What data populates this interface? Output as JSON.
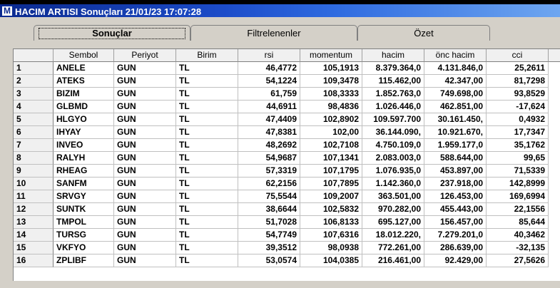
{
  "window": {
    "app_icon_letter": "M",
    "title": "HACIM ARTISI Sonuçları  21/01/23 17:07:28"
  },
  "tabs": [
    {
      "label": "Sonuçlar",
      "active": true
    },
    {
      "label": "Filtrelenenler",
      "active": false
    },
    {
      "label": "Özet",
      "active": false
    }
  ],
  "table": {
    "columns": [
      "Sembol",
      "Periyot",
      "Birim",
      "rsi",
      "momentum",
      "hacim",
      "önc hacim",
      "cci"
    ],
    "rows": [
      [
        "1",
        "ANELE",
        "GUN",
        "TL",
        "46,4772",
        "105,1913",
        "8.379.364,0",
        "4.131.846,0",
        "25,2611"
      ],
      [
        "2",
        "ATEKS",
        "GUN",
        "TL",
        "54,1224",
        "109,3478",
        "115.462,00",
        "42.347,00",
        "81,7298"
      ],
      [
        "3",
        "BIZIM",
        "GUN",
        "TL",
        "61,759",
        "108,3333",
        "1.852.763,0",
        "749.698,00",
        "93,8529"
      ],
      [
        "4",
        "GLBMD",
        "GUN",
        "TL",
        "44,6911",
        "98,4836",
        "1.026.446,0",
        "462.851,00",
        "-17,624"
      ],
      [
        "5",
        "HLGYO",
        "GUN",
        "TL",
        "47,4409",
        "102,8902",
        "109.597.700",
        "30.161.450,",
        "0,4932"
      ],
      [
        "6",
        "IHYAY",
        "GUN",
        "TL",
        "47,8381",
        "102,00",
        "36.144.090,",
        "10.921.670,",
        "17,7347"
      ],
      [
        "7",
        "INVEO",
        "GUN",
        "TL",
        "48,2692",
        "102,7108",
        "4.750.109,0",
        "1.959.177,0",
        "35,1762"
      ],
      [
        "8",
        "RALYH",
        "GUN",
        "TL",
        "54,9687",
        "107,1341",
        "2.083.003,0",
        "588.644,00",
        "99,65"
      ],
      [
        "9",
        "RHEAG",
        "GUN",
        "TL",
        "57,3319",
        "107,1795",
        "1.076.935,0",
        "453.897,00",
        "71,5339"
      ],
      [
        "10",
        "SANFM",
        "GUN",
        "TL",
        "62,2156",
        "107,7895",
        "1.142.360,0",
        "237.918,00",
        "142,8999"
      ],
      [
        "11",
        "SRVGY",
        "GUN",
        "TL",
        "75,5544",
        "109,2007",
        "363.501,00",
        "126.453,00",
        "169,6994"
      ],
      [
        "12",
        "SUNTK",
        "GUN",
        "TL",
        "38,6644",
        "102,5832",
        "970.282,00",
        "455.443,00",
        "22,1556"
      ],
      [
        "13",
        "TMPOL",
        "GUN",
        "TL",
        "51,7028",
        "106,8133",
        "695.127,00",
        "156.457,00",
        "85,644"
      ],
      [
        "14",
        "TURSG",
        "GUN",
        "TL",
        "54,7749",
        "107,6316",
        "18.012.220,",
        "7.279.201,0",
        "40,3462"
      ],
      [
        "15",
        "VKFYO",
        "GUN",
        "TL",
        "39,3512",
        "98,0938",
        "772.261,00",
        "286.639,00",
        "-32,135"
      ],
      [
        "16",
        "ZPLIBF",
        "GUN",
        "TL",
        "53,0574",
        "104,0385",
        "216.461,00",
        "92.429,00",
        "27,5626"
      ]
    ]
  }
}
